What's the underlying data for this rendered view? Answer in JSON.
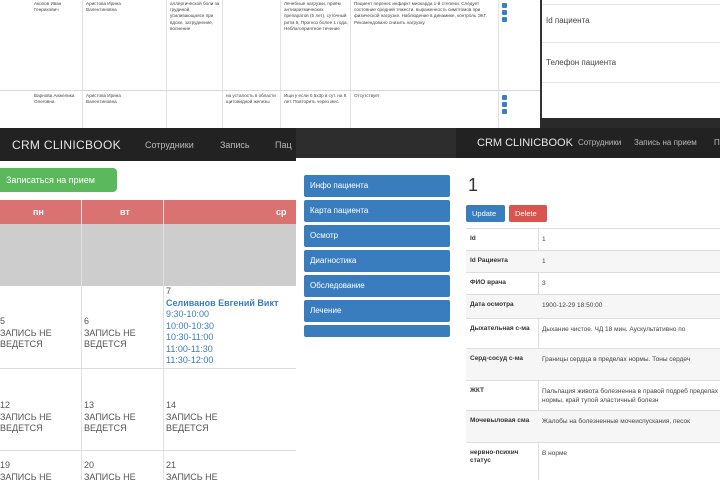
{
  "back_table": {
    "row1": {
      "patient": "Акопов Иван Генрихович",
      "doctor": "Аристова Ирина Валентиновна",
      "complaints": "аллергической боли за грудиной, усиливающаяся при вдохе, затруднение, волнение",
      "anamnesis": "Лечебные нагрузки, приём антиаритмических препаратов (5 лет), суточный ритм 8, Прогноз более 1 года, Неблагоприятное течение",
      "conclusion": "Пациент перенес инфаркт миокарда 1-й степени. Следует состояние средней тяжести, выраженность симптомов при физической нагрузке. Наблюдение в динамике, контроль ЭКГ. Рекомендовано снизить нагрузку."
    },
    "row2": {
      "patient": "Варнова Анжелика Олеговна",
      "doctor": "Аристова Ирина Валентиновна",
      "complaints": "на усталость в области щитовидной железы",
      "anamnesis": "Ищи у если 0.5х3р в сут. на 6 лет. Повторить через мес.",
      "conclusion": "Отсутствует"
    }
  },
  "back_fields": {
    "patient_id": "Id пациента",
    "phone": "Телефон пациента"
  },
  "calendar_panel": {
    "brand": "CRM CLINICBOOK",
    "nav": [
      "Сотрудники",
      "Запись",
      "Пац"
    ],
    "signup_button": "Записаться на прием",
    "weekdays": [
      "пн",
      "вт",
      "ср"
    ],
    "weeks": [
      {
        "mon": {
          "day": "5",
          "status": "ЗАПИСЬ НЕ ВЕДЕТСЯ"
        },
        "tue": {
          "day": "6",
          "status": "ЗАПИСЬ НЕ ВЕДЕТСЯ"
        },
        "wed": {
          "day": "7",
          "doctor": "Селиванов Евгений Викт",
          "slots": [
            "9:30-10:00",
            "10:00-10:30",
            "10:30-11:00",
            "11:00-11:30",
            "11:30-12:00"
          ]
        }
      },
      {
        "mon": {
          "day": "12",
          "status": "ЗАПИСЬ НЕ ВЕДЕТСЯ"
        },
        "tue": {
          "day": "13",
          "status": "ЗАПИСЬ НЕ ВЕДЕТСЯ"
        },
        "wed": {
          "day": "14",
          "status": "ЗАПИСЬ НЕ ВЕДЕТСЯ"
        }
      },
      {
        "mon": {
          "day": "19",
          "status": "ЗАПИСЬ НЕ"
        },
        "tue": {
          "day": "20",
          "status": "ЗАПИСЬ НЕ"
        },
        "wed": {
          "day": "21",
          "status": "ЗАПИСЬ НЕ"
        }
      }
    ]
  },
  "inspection_panel": {
    "brand": "CRM CLINICBOOK",
    "nav": [
      "Сотрудники",
      "Запись на прием",
      "П"
    ],
    "menu": [
      "Инфо пациента",
      "Карта пациента",
      "Осмотр",
      "Диагностика",
      "Обследование",
      "Лечение"
    ],
    "record_id": "1",
    "update_button": "Update",
    "delete_button": "Delete",
    "rows": [
      {
        "key": "Id",
        "value": "1"
      },
      {
        "key": "Id Pациента",
        "value": "1"
      },
      {
        "key": "ФИО врача",
        "value": "3"
      },
      {
        "key": "Дата осмотра",
        "value": "1900-12-29 18:50:00"
      },
      {
        "key": "Дыхательная с-ма",
        "value": "Дыхание чистое. ЧД 18 мин. Аускультативно по"
      },
      {
        "key": "Серд-сосуд с-ма",
        "value": "Границы сердца в пределах нормы. Тоны сердеч"
      },
      {
        "key": "ЖКТ",
        "value": "Пальпация живота болезненна в правой подреб пределах нормы, край тупой эластичный болезн"
      },
      {
        "key": "Мочевыловая сма",
        "value": "Жалобы на болезненные мочеиспускания, песок"
      },
      {
        "key": "нервно-психич статус",
        "value": "В норме"
      }
    ]
  },
  "colors": {
    "navbar": "#222222",
    "primary": "#3a7dbf",
    "success": "#5cb85c",
    "danger": "#d9534f",
    "calendar_header": "#db7272"
  }
}
